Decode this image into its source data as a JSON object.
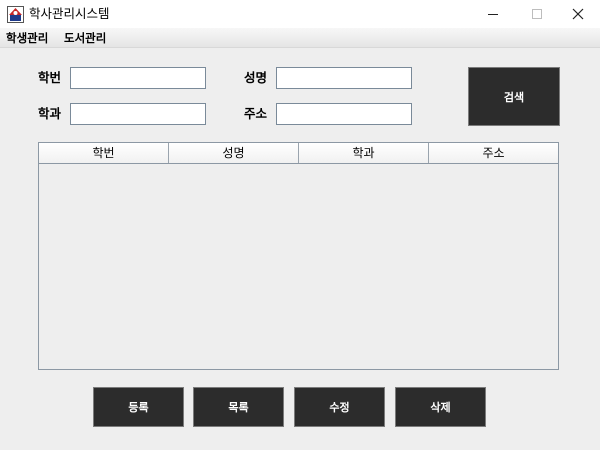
{
  "window": {
    "title": "학사관리시스템",
    "icon": "app-logo-icon"
  },
  "menu": {
    "items": [
      {
        "label": "학생관리"
      },
      {
        "label": "도서관리"
      }
    ]
  },
  "form": {
    "student_id_label": "학번",
    "name_label": "성명",
    "department_label": "학과",
    "address_label": "주소",
    "student_id_value": "",
    "name_value": "",
    "department_value": "",
    "address_value": "",
    "search_button": "검색"
  },
  "table": {
    "columns": [
      "학번",
      "성명",
      "학과",
      "주소"
    ],
    "rows": []
  },
  "actions": {
    "register": "등록",
    "list": "목록",
    "edit": "수정",
    "delete": "삭제"
  },
  "colors": {
    "button_bg": "#2c2c2c",
    "background": "#eeeeee"
  }
}
